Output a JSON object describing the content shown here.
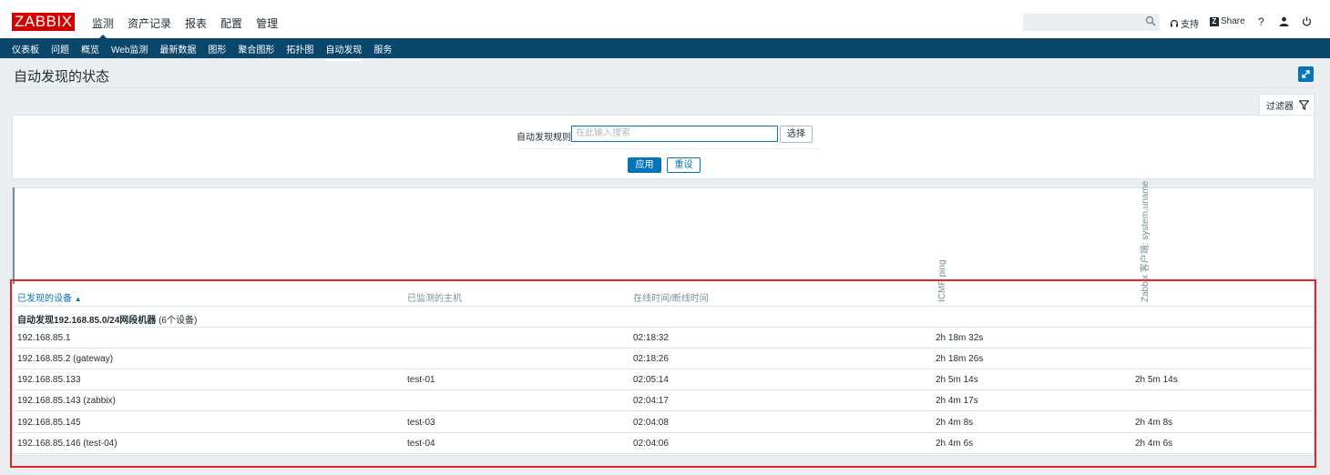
{
  "header": {
    "logo": "ZABBIX",
    "nav": [
      "监测",
      "资产记录",
      "报表",
      "配置",
      "管理"
    ],
    "support_label": "支持",
    "share_label": "Share",
    "share_badge": "Z",
    "help_label": "?"
  },
  "subnav": [
    "仪表板",
    "问题",
    "概览",
    "Web监测",
    "最新数据",
    "图形",
    "聚合图形",
    "拓扑图",
    "自动发现",
    "服务"
  ],
  "page": {
    "title": "自动发现的状态",
    "filter_tab_label": "过滤器"
  },
  "filter": {
    "rule_label": "自动发现规则",
    "rule_placeholder": "在此输入搜索",
    "select_button": "选择",
    "apply_button": "应用",
    "reset_button": "重设"
  },
  "table": {
    "columns": {
      "device": "已发现的设备",
      "host": "已监测的主机",
      "uptime": "在线时间/断线时间",
      "icmp": "ICMP ping",
      "agent": "Zabbix 客户端: system.uname"
    },
    "sort_arrow": "▲",
    "group": {
      "name": "自动发现192.168.85.0/24网段机器",
      "count": "(6个设备)"
    },
    "rows": [
      {
        "device": "192.168.85.1",
        "host": "",
        "uptime": "02:18:32",
        "icmp": "2h 18m 32s",
        "agent": ""
      },
      {
        "device": "192.168.85.2 (gateway)",
        "host": "",
        "uptime": "02:18:26",
        "icmp": "2h 18m 26s",
        "agent": ""
      },
      {
        "device": "192.168.85.133",
        "host": "test-01",
        "uptime": "02:05:14",
        "icmp": "2h 5m 14s",
        "agent": "2h 5m 14s"
      },
      {
        "device": "192.168.85.143 (zabbix)",
        "host": "",
        "uptime": "02:04:17",
        "icmp": "2h 4m 17s",
        "agent": ""
      },
      {
        "device": "192.168.85.145",
        "host": "test-03",
        "uptime": "02:04:08",
        "icmp": "2h 4m 8s",
        "agent": "2h 4m 8s"
      },
      {
        "device": "192.168.85.146 (test-04)",
        "host": "test-04",
        "uptime": "02:04:06",
        "icmp": "2h 4m 6s",
        "agent": "2h 4m 6s"
      }
    ]
  },
  "colors": {
    "brand_red": "#d40000",
    "nav_blue": "#0a466a",
    "accent_blue": "#0275b8",
    "highlight_red": "#e0262d"
  }
}
